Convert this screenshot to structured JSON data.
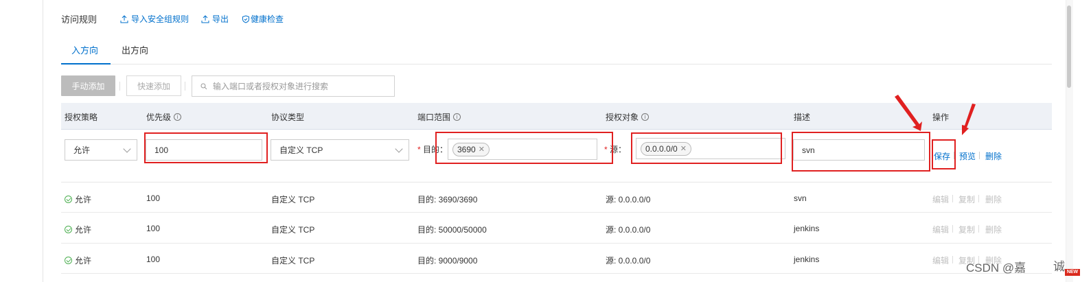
{
  "header": {
    "title": "访问规则",
    "import_label": "导入安全组规则",
    "export_label": "导出",
    "health_label": "健康检查"
  },
  "tabs": [
    {
      "label": "入方向"
    },
    {
      "label": "出方向"
    }
  ],
  "toolbar": {
    "manual_add": "手动添加",
    "quick_add": "快速添加",
    "search_placeholder": "输入端口或者授权对象进行搜索"
  },
  "columns": {
    "policy": "授权策略",
    "priority": "优先级",
    "protocol": "协议类型",
    "port": "端口范围",
    "object": "授权对象",
    "desc": "描述",
    "action": "操作"
  },
  "edit_row": {
    "policy": "允许",
    "priority": "100",
    "protocol": "自定义 TCP",
    "dest_label": "目的：",
    "dest_tag": "3690",
    "source_label": "源：",
    "source_tag": "0.0.0.0/0",
    "desc": "svn",
    "save": "保存",
    "preview": "预览",
    "delete": "删除"
  },
  "rows": [
    {
      "policy": "允许",
      "priority": "100",
      "protocol": "自定义 TCP",
      "port": "目的: 3690/3690",
      "object": "源: 0.0.0.0/0",
      "desc": "svn"
    },
    {
      "policy": "允许",
      "priority": "100",
      "protocol": "自定义 TCP",
      "port": "目的: 50000/50000",
      "object": "源: 0.0.0.0/0",
      "desc": "jenkins"
    },
    {
      "policy": "允许",
      "priority": "100",
      "protocol": "自定义 TCP",
      "port": "目的: 9000/9000",
      "object": "源: 0.0.0.0/0",
      "desc": "jenkins"
    }
  ],
  "row_actions": {
    "edit": "编辑",
    "copy": "复制",
    "delete": "删除"
  },
  "watermark": {
    "text": "CSDN @嘉",
    "text2": "诚",
    "badge": "NEW"
  },
  "colors": {
    "accent": "#0070cc",
    "annotation": "#e02020",
    "header_bg": "#eef1f6"
  }
}
